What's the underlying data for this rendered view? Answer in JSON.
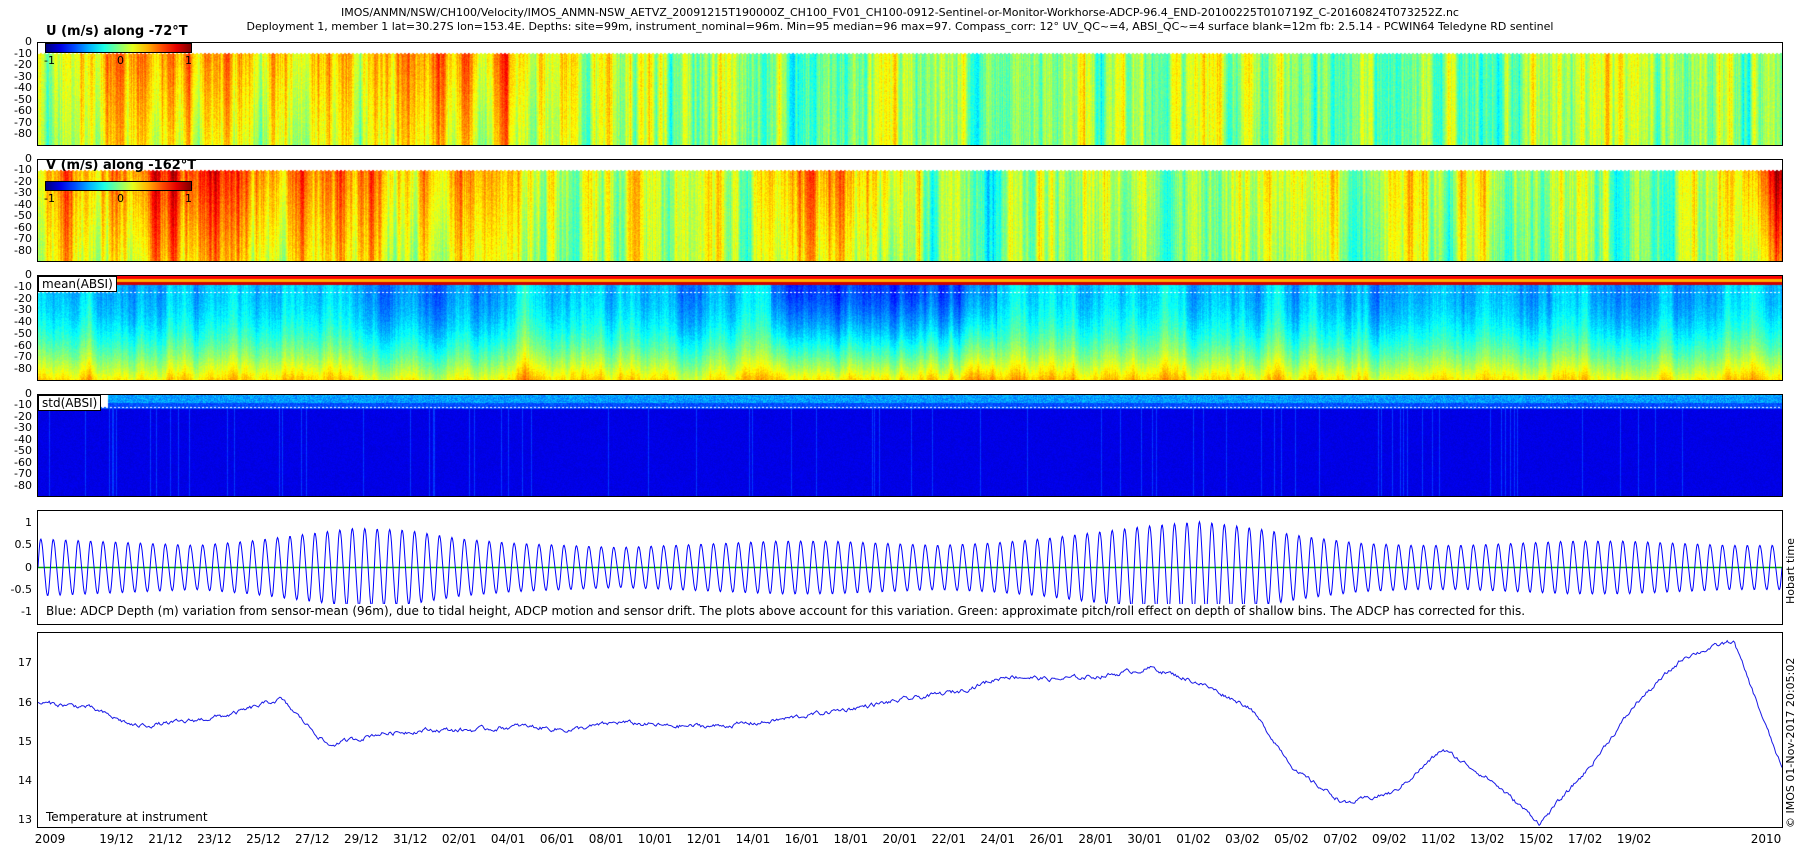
{
  "header": {
    "line1": "IMOS/ANMN/NSW/CH100/Velocity/IMOS_ANMN-NSW_AETVZ_20091215T190000Z_CH100_FV01_CH100-0912-Sentinel-or-Monitor-Workhorse-ADCP-96.4_END-20100225T010719Z_C-20160824T073252Z.nc",
    "line2": "Deployment 1, member 1 lat=30.27S lon=153.4E. Depths: site=99m, instrument_nominal=96m. Min=95 median=96 max=97. Compass_corr: 12° UV_QC~=4, ABSI_QC~=4 surface blank=12m fb: 2.5.14 - PCWIN64 Teledyne RD sentinel"
  },
  "side_text": {
    "hobart": "Hobart time",
    "imos": "© IMOS 01-Nov-2017 20:05:02"
  },
  "panels": {
    "u": {
      "title": "U (m/s) along -72°T",
      "cbar_ticks": [
        "-1",
        "0",
        "1"
      ]
    },
    "v": {
      "title": "V (m/s) along -162°T",
      "cbar_ticks": [
        "-1",
        "0",
        "1"
      ]
    },
    "mean": {
      "label": "mean(ABSI)"
    },
    "std": {
      "label": "std(ABSI)"
    },
    "depth": {
      "note": "Blue: ADCP Depth (m) variation from sensor-mean (96m), due to tidal height, ADCP motion and sensor drift. The plots above account for this variation. Green: approximate pitch/roll effect on depth of shallow bins. The ADCP has corrected for this."
    },
    "temp": {
      "label": "Temperature at instrument"
    }
  },
  "yticks": {
    "profile": [
      "0",
      "-10",
      "-20",
      "-30",
      "-40",
      "-50",
      "-60",
      "-70",
      "-80"
    ],
    "depth": [
      "1",
      "0.5",
      "0",
      "-0.5",
      "-1"
    ],
    "temp": [
      "17",
      "16",
      "15",
      "14",
      "13"
    ]
  },
  "xticks": [
    "2009",
    "19/12",
    "21/12",
    "23/12",
    "25/12",
    "27/12",
    "29/12",
    "31/12",
    "02/01",
    "04/01",
    "06/01",
    "08/01",
    "10/01",
    "12/01",
    "14/01",
    "16/01",
    "18/01",
    "20/01",
    "22/01",
    "24/01",
    "26/01",
    "28/01",
    "30/01",
    "01/02",
    "03/02",
    "05/02",
    "07/02",
    "09/02",
    "11/02",
    "13/02",
    "15/02",
    "17/02",
    "19/02",
    "2010"
  ],
  "colors": {
    "depth_line": "#0000ff",
    "pitch_line": "#00aa00",
    "temp_line": "#1a1ae6"
  },
  "chart_data": [
    {
      "type": "heatmap",
      "title": "U (m/s) along -72°T",
      "ylim": [
        -90,
        0
      ],
      "clim": [
        -1,
        1
      ],
      "colormap": "jet",
      "y_ticks": [
        0,
        -10,
        -20,
        -30,
        -40,
        -50,
        -60,
        -70,
        -80
      ],
      "surface_blank_depth": -12,
      "x_start": "2009-12-15",
      "x_end": "2010-02-25",
      "column_means": [
        0.15,
        0.3,
        0.45,
        0.5,
        0.4,
        0.35,
        0.3,
        0.4,
        0.45,
        0.35,
        0.2,
        0.1,
        0.05,
        0.05,
        0.0,
        -0.05,
        0.0,
        0.05,
        0.1,
        0.0,
        -0.05,
        0.0,
        0.1,
        0.15,
        0.05,
        0.0,
        0.0,
        0.0,
        0.05,
        0.1,
        0.15,
        0.1,
        0.05,
        0.0
      ]
    },
    {
      "type": "heatmap",
      "title": "V (m/s) along -162°T",
      "ylim": [
        -90,
        0
      ],
      "clim": [
        -1,
        1
      ],
      "colormap": "jet",
      "y_ticks": [
        0,
        -10,
        -20,
        -30,
        -40,
        -50,
        -60,
        -70,
        -80
      ],
      "surface_blank_depth": -12,
      "x_start": "2009-12-15",
      "x_end": "2010-02-25",
      "column_means": [
        0.35,
        0.45,
        0.6,
        0.65,
        0.6,
        0.5,
        0.45,
        0.4,
        0.45,
        0.35,
        0.2,
        0.1,
        0.05,
        0.05,
        0.3,
        0.45,
        0.35,
        0.1,
        -0.1,
        0.0,
        0.2,
        0.15,
        0.0,
        0.2,
        0.25,
        0.2,
        0.15,
        0.25,
        0.2,
        0.1,
        0.0,
        0.1,
        0.2,
        0.9
      ]
    },
    {
      "type": "heatmap",
      "title": "mean(ABSI)",
      "ylim": [
        -90,
        0
      ],
      "colormap": "jet",
      "y_ticks": [
        0,
        -10,
        -20,
        -30,
        -40,
        -50,
        -60,
        -70,
        -80
      ],
      "note": "surface rows high (red), mid depth low (blue), bottom rows higher (green-yellow)"
    },
    {
      "type": "heatmap",
      "title": "std(ABSI)",
      "ylim": [
        -90,
        0
      ],
      "colormap": "jet",
      "y_ticks": [
        0,
        -10,
        -20,
        -30,
        -40,
        -50,
        -60,
        -70,
        -80
      ],
      "note": "mostly low (dark blue) with higher values near the surface"
    },
    {
      "type": "line",
      "ylim": [
        -1.3,
        1.3
      ],
      "y_ticks": [
        1,
        0.5,
        0,
        -0.5,
        -1
      ],
      "series": [],
      "description_series": {
        "depth_variation": {
          "semidiurnal_cycles": 140,
          "amplitude_envelope": [
            0.65,
            0.6,
            0.55,
            0.5,
            0.6,
            0.75,
            0.9,
            0.85,
            0.65,
            0.55,
            0.5,
            0.45,
            0.5,
            0.55,
            0.6,
            0.6,
            0.55,
            0.5,
            0.55,
            0.65,
            0.8,
            0.95,
            1.05,
            0.9,
            0.7,
            0.55,
            0.5,
            0.5,
            0.55,
            0.6,
            0.6,
            0.55,
            0.5,
            0.5
          ]
        },
        "pitch_roll_effect": {
          "values": [
            0.0
          ]
        }
      }
    },
    {
      "type": "line",
      "ylim": [
        12.8,
        17.8
      ],
      "y_ticks": [
        17,
        16,
        15,
        14,
        13
      ],
      "x": [
        "2009-12-15",
        "2009-12-17",
        "2009-12-19",
        "2009-12-21",
        "2009-12-23",
        "2009-12-25",
        "2009-12-27",
        "2009-12-29",
        "2009-12-31",
        "2010-01-02",
        "2010-01-04",
        "2010-01-06",
        "2010-01-08",
        "2010-01-10",
        "2010-01-12",
        "2010-01-14",
        "2010-01-16",
        "2010-01-18",
        "2010-01-20",
        "2010-01-22",
        "2010-01-24",
        "2010-01-26",
        "2010-01-28",
        "2010-01-30",
        "2010-02-01",
        "2010-02-03",
        "2010-02-05",
        "2010-02-07",
        "2010-02-09",
        "2010-02-11",
        "2010-02-13",
        "2010-02-15",
        "2010-02-17",
        "2010-02-19",
        "2010-02-21",
        "2010-02-23",
        "2010-02-25"
      ],
      "y": [
        16.0,
        15.9,
        15.4,
        15.5,
        15.7,
        16.1,
        14.9,
        15.2,
        15.3,
        15.3,
        15.4,
        15.3,
        15.5,
        15.4,
        15.4,
        15.5,
        15.7,
        15.9,
        16.1,
        16.3,
        16.7,
        16.6,
        16.7,
        16.9,
        16.5,
        15.9,
        14.2,
        13.4,
        13.7,
        14.8,
        14.0,
        12.9,
        14.3,
        16.0,
        17.2,
        17.6,
        14.3
      ]
    }
  ]
}
